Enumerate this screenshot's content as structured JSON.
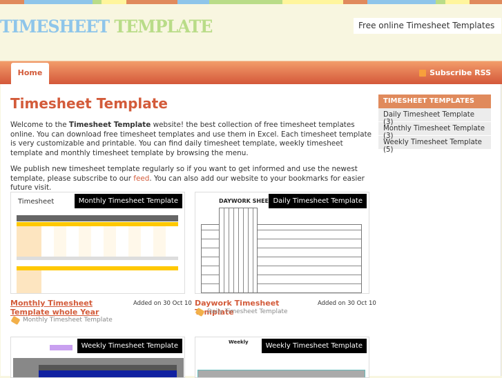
{
  "header": {
    "logo_part1": "TIMESHEET",
    "logo_part2": "TEMPLATE",
    "tagline": "Free online Timesheet Templates"
  },
  "nav": {
    "home": "Home",
    "subscribe": "Subscribe RSS"
  },
  "main": {
    "title": "Timesheet Template",
    "intro_pre": "Welcome to the ",
    "intro_bold": "Timesheet Template",
    "intro_post": " website! the best collection of free timesheet templates online. You can download free timesheet templates and use them in Excel. Each timesheet template is very customizable and printable. You can find daily timesheet template, weekly timesheet template and monthly timesheet template by browsing the menu.",
    "para2_pre": "We publish new timesheet template regularly so if you want to get informed and use the newest template, please subscribe to our ",
    "para2_link": "feed",
    "para2_post": ". You can also add our website to your bookmarks for easier future visit.",
    "posts": [
      {
        "badge": "Monthly Timesheet Template",
        "title": "Monthly Timesheet Template whole Year",
        "added": "Added on 30 Oct 10",
        "category": "Monthly Timesheet Template",
        "thumb_heading": "Timesheet"
      },
      {
        "badge": "Daily Timesheet Template",
        "title": "Daywork Timesheet Template",
        "added": "Added on 30 Oct 10",
        "category": "Daily Timesheet Template",
        "thumb_heading": "DAYWORK SHEET"
      },
      {
        "badge": "Weekly Timesheet Template"
      },
      {
        "badge": "Weekly Timesheet Template",
        "thumb_heading": "Weekly"
      }
    ]
  },
  "sidebar": {
    "heading": "TIMESHEET TEMPLATES",
    "items": [
      {
        "label": "Daily Timesheet Template (3)"
      },
      {
        "label": "Monthly Timesheet Template (3)"
      },
      {
        "label": "Weekly Timesheet Template (5)"
      }
    ]
  },
  "colors": {
    "accent": "#d35b3a",
    "stripe": [
      "#e08a5c",
      "#8ec5ea",
      "#b9dc88",
      "#fff59c"
    ]
  }
}
